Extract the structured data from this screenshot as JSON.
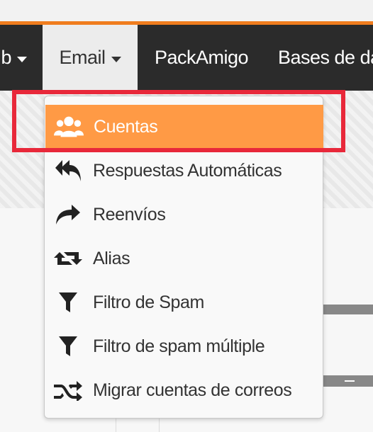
{
  "navbar": {
    "items": [
      {
        "label": "b",
        "has_caret": true
      },
      {
        "label": "Email",
        "has_caret": true
      },
      {
        "label": "PackAmigo"
      },
      {
        "label": "Bases de da"
      }
    ]
  },
  "dropdown": {
    "items": [
      {
        "label": "Cuentas",
        "icon": "users-icon",
        "active": true
      },
      {
        "label": "Respuestas Automáticas",
        "icon": "reply-all-icon"
      },
      {
        "label": "Reenvíos",
        "icon": "forward-icon"
      },
      {
        "label": "Alias",
        "icon": "retweet-icon"
      },
      {
        "label": "Filtro de Spam",
        "icon": "filter-icon"
      },
      {
        "label": "Filtro de spam múltiple",
        "icon": "filter-icon"
      },
      {
        "label": "Migrar cuentas de correos",
        "icon": "random-icon"
      }
    ]
  },
  "colors": {
    "accent": "#f07d1e",
    "active_item": "#ff9a45",
    "highlight_box": "#e8283a",
    "navbar_bg": "#2b2b2b"
  }
}
